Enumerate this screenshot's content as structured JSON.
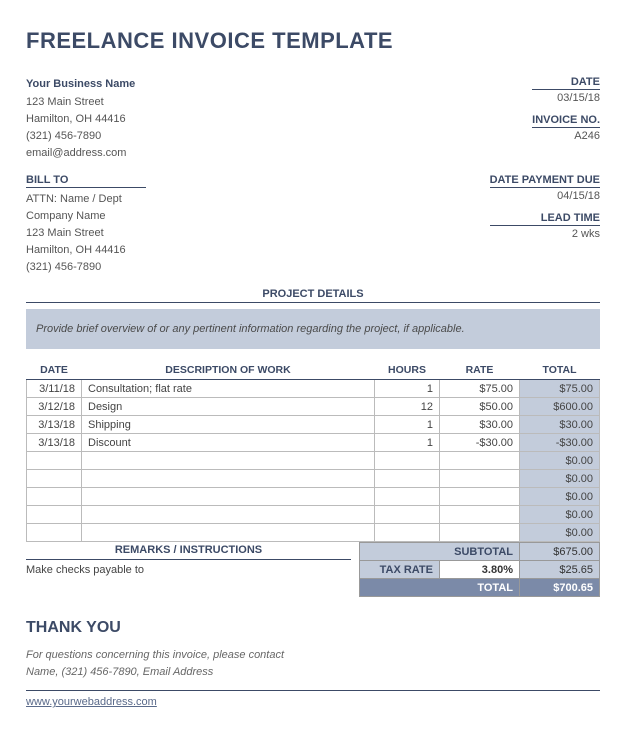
{
  "title": "FREELANCE INVOICE TEMPLATE",
  "business": {
    "name": "Your Business Name",
    "street": "123 Main Street",
    "city": "Hamilton, OH 44416",
    "phone": "(321) 456-7890",
    "email": "email@address.com"
  },
  "meta": {
    "date_label": "DATE",
    "date": "03/15/18",
    "invoice_no_label": "INVOICE NO.",
    "invoice_no": "A246",
    "due_label": "DATE PAYMENT DUE",
    "due": "04/15/18",
    "lead_label": "LEAD TIME",
    "lead": "2 wks"
  },
  "billto": {
    "header": "BILL TO",
    "attn": "ATTN: Name / Dept",
    "company": "Company Name",
    "street": "123 Main Street",
    "city": "Hamilton, OH 44416",
    "phone": "(321) 456-7890"
  },
  "project": {
    "header": "PROJECT DETAILS",
    "text": "Provide brief overview of or any pertinent information regarding the project, if applicable."
  },
  "columns": {
    "date": "DATE",
    "desc": "DESCRIPTION OF WORK",
    "hours": "HOURS",
    "rate": "RATE",
    "total": "TOTAL"
  },
  "rows": [
    {
      "date": "3/11/18",
      "desc": "Consultation; flat rate",
      "hours": "1",
      "rate": "$75.00",
      "total": "$75.00"
    },
    {
      "date": "3/12/18",
      "desc": "Design",
      "hours": "12",
      "rate": "$50.00",
      "total": "$600.00"
    },
    {
      "date": "3/13/18",
      "desc": "Shipping",
      "hours": "1",
      "rate": "$30.00",
      "total": "$30.00"
    },
    {
      "date": "3/13/18",
      "desc": "Discount",
      "hours": "1",
      "rate": "-$30.00",
      "total": "-$30.00"
    },
    {
      "date": "",
      "desc": "",
      "hours": "",
      "rate": "",
      "total": "$0.00"
    },
    {
      "date": "",
      "desc": "",
      "hours": "",
      "rate": "",
      "total": "$0.00"
    },
    {
      "date": "",
      "desc": "",
      "hours": "",
      "rate": "",
      "total": "$0.00"
    },
    {
      "date": "",
      "desc": "",
      "hours": "",
      "rate": "",
      "total": "$0.00"
    },
    {
      "date": "",
      "desc": "",
      "hours": "",
      "rate": "",
      "total": "$0.00"
    }
  ],
  "remarks": {
    "header": "REMARKS / INSTRUCTIONS",
    "text": "Make checks payable to"
  },
  "totals": {
    "subtotal_label": "SUBTOTAL",
    "subtotal": "$675.00",
    "taxrate_label": "TAX RATE",
    "taxrate": "3.80%",
    "tax": "$25.65",
    "total_label": "TOTAL",
    "total": "$700.65"
  },
  "footer": {
    "thankyou": "THANK YOU",
    "contact_line1": "For questions concerning this invoice, please contact",
    "contact_line2": "Name, (321) 456-7890, Email Address",
    "web": "www.yourwebaddress.com"
  }
}
